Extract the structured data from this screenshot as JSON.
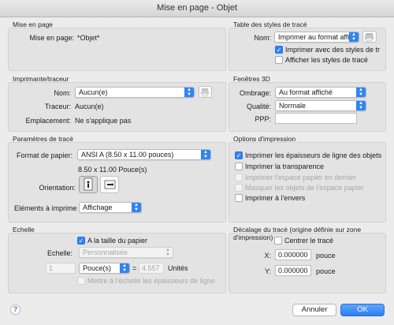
{
  "window": {
    "title": "Mise en page - Objet"
  },
  "page_setup": {
    "title": "Mise en page",
    "label": "Mise en page:",
    "value": "*Objet*"
  },
  "plot_style_table": {
    "title": "Table des styles de tracé",
    "name_label": "Nom:",
    "name_value": "Imprimer au format affic",
    "print_with_styles": {
      "label": "Imprimer avec des styles de tr",
      "checked": true
    },
    "display_styles": {
      "label": "Afficher les styles de tracé",
      "checked": false
    },
    "edit_icon": "printer-edit-icon"
  },
  "printer": {
    "title": "Imprimante/traceur",
    "name_label": "Nom:",
    "name_value": "Aucun(e)",
    "plotter_label": "Traceur:",
    "plotter_value": "Aucun(e)",
    "location_label": "Emplacement:",
    "location_value": "Ne s'applique pas",
    "properties_icon": "printer-properties-icon"
  },
  "viewports_3d": {
    "title": "Fenêtres 3D",
    "shade_label": "Ombrage:",
    "shade_value": "Au format affiché",
    "quality_label": "Qualité:",
    "quality_value": "Normale",
    "dpi_label": "PPP:",
    "dpi_value": ""
  },
  "plot_params": {
    "title": "Paramètres de tracé",
    "paper_label": "Format de papier:",
    "paper_value": "ANSI A (8.50 x 11.00 pouces)",
    "paper_size_text": "8.50 x 11.00 Pouce(s)",
    "orientation_label": "Orientation:",
    "orientation_options": [
      "portrait",
      "landscape"
    ],
    "orientation_selected": "portrait",
    "plot_area_label": "Eléments à imprime",
    "plot_area_value": "Affichage"
  },
  "print_options": {
    "title": "Options d'impression",
    "items": [
      {
        "label": "Imprimer les épaisseurs de ligne des objets",
        "checked": true,
        "enabled": true
      },
      {
        "label": "Imprimer la transparence",
        "checked": false,
        "enabled": true
      },
      {
        "label": "Imprimer l'espace papier en dernier",
        "checked": false,
        "enabled": false
      },
      {
        "label": "Masquer les objets de l'espace papier",
        "checked": false,
        "enabled": false
      },
      {
        "label": "Imprimer à l'envers",
        "checked": false,
        "enabled": true
      }
    ]
  },
  "scale": {
    "title": "Echelle",
    "fit_to_paper": {
      "label": "A la taille du papier",
      "checked": true
    },
    "scale_label": "Echelle:",
    "scale_value": "Personnalisée",
    "numerator": "1",
    "unit_value": "Pouce(s)",
    "equals": "=",
    "denominator": "4.557",
    "units_label": "Unités",
    "scale_lineweights": {
      "label": "Mettre à l'échelle les épaisseurs de ligne",
      "checked": false
    }
  },
  "plot_offset": {
    "title": "Décalage du tracé (origine définie sur zone d'impression)",
    "center": {
      "label": "Centrer le tracé",
      "checked": false
    },
    "x_label": "X:",
    "x_value": "0.000000",
    "x_unit": "pouce",
    "y_label": "Y:",
    "y_value": "0.000000",
    "y_unit": "pouce"
  },
  "footer": {
    "help": "?",
    "cancel": "Annuler",
    "ok": "OK"
  },
  "colors": {
    "accent": "#2f84f4",
    "window_bg": "#ececec",
    "group_bg": "#e3e3e3"
  }
}
